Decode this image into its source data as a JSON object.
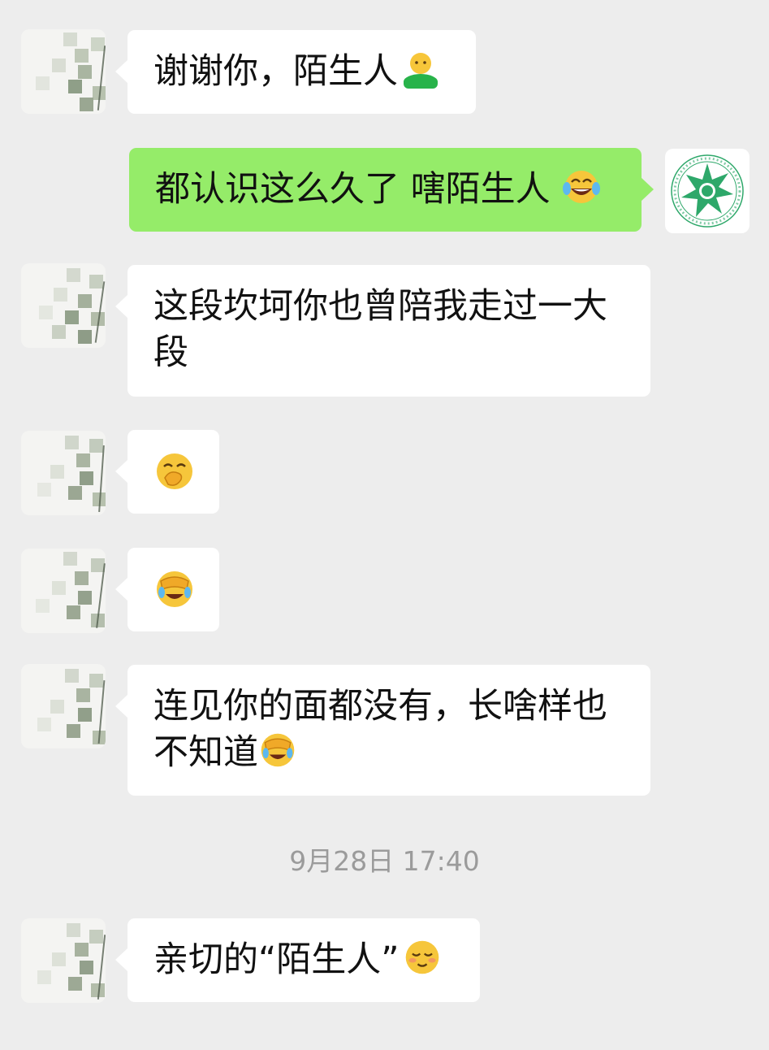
{
  "messages": [
    {
      "side": "left",
      "text": "谢谢你，陌生人",
      "emoji": "person-green-shirt-emoji"
    },
    {
      "side": "right",
      "text": "都认识这么久了 嗐陌生人",
      "emoji": "tears-of-joy-emoji"
    },
    {
      "side": "left",
      "text_line1": "这段坎坷你也曾陪我走过一大",
      "text_line2": "段"
    },
    {
      "side": "left",
      "emoji": "hand-over-mouth-emoji"
    },
    {
      "side": "left",
      "emoji": "facepalm-crying-emoji"
    },
    {
      "side": "left",
      "text_line1": "连见你的面都没有，长啥样也",
      "text_line2": "不知道",
      "emoji": "facepalm-crying-emoji"
    },
    {
      "side": "left",
      "text": "亲切的“陌生人”",
      "emoji": "blushing-smile-emoji"
    }
  ],
  "timestamp": "9月28日 17:40",
  "colors": {
    "background": "#ededed",
    "incoming_bubble": "#ffffff",
    "outgoing_bubble": "#95ec69",
    "timestamp_text": "#9b9b9b",
    "seal_green": "#2ea86a"
  }
}
